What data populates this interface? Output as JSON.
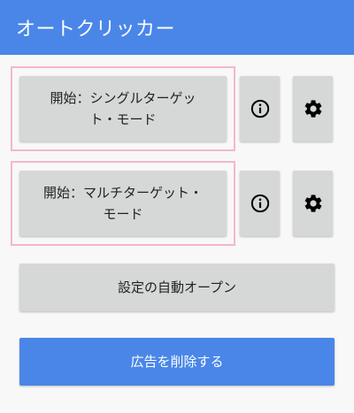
{
  "app_bar": {
    "title": "オートクリッカー"
  },
  "buttons": {
    "start_single": "開始：シングルターゲット・モード",
    "start_multi": "開始：マルチターゲット・モード",
    "auto_open_settings": "設定の自動オープン",
    "remove_ads": "広告を削除する"
  },
  "icons": {
    "info": "info-icon",
    "settings": "gear-icon"
  },
  "colors": {
    "app_bar": "#4a86e8",
    "highlight_border": "#f4b6cf",
    "button_gray": "#d6d7d7",
    "button_blue": "#4a86e8"
  }
}
